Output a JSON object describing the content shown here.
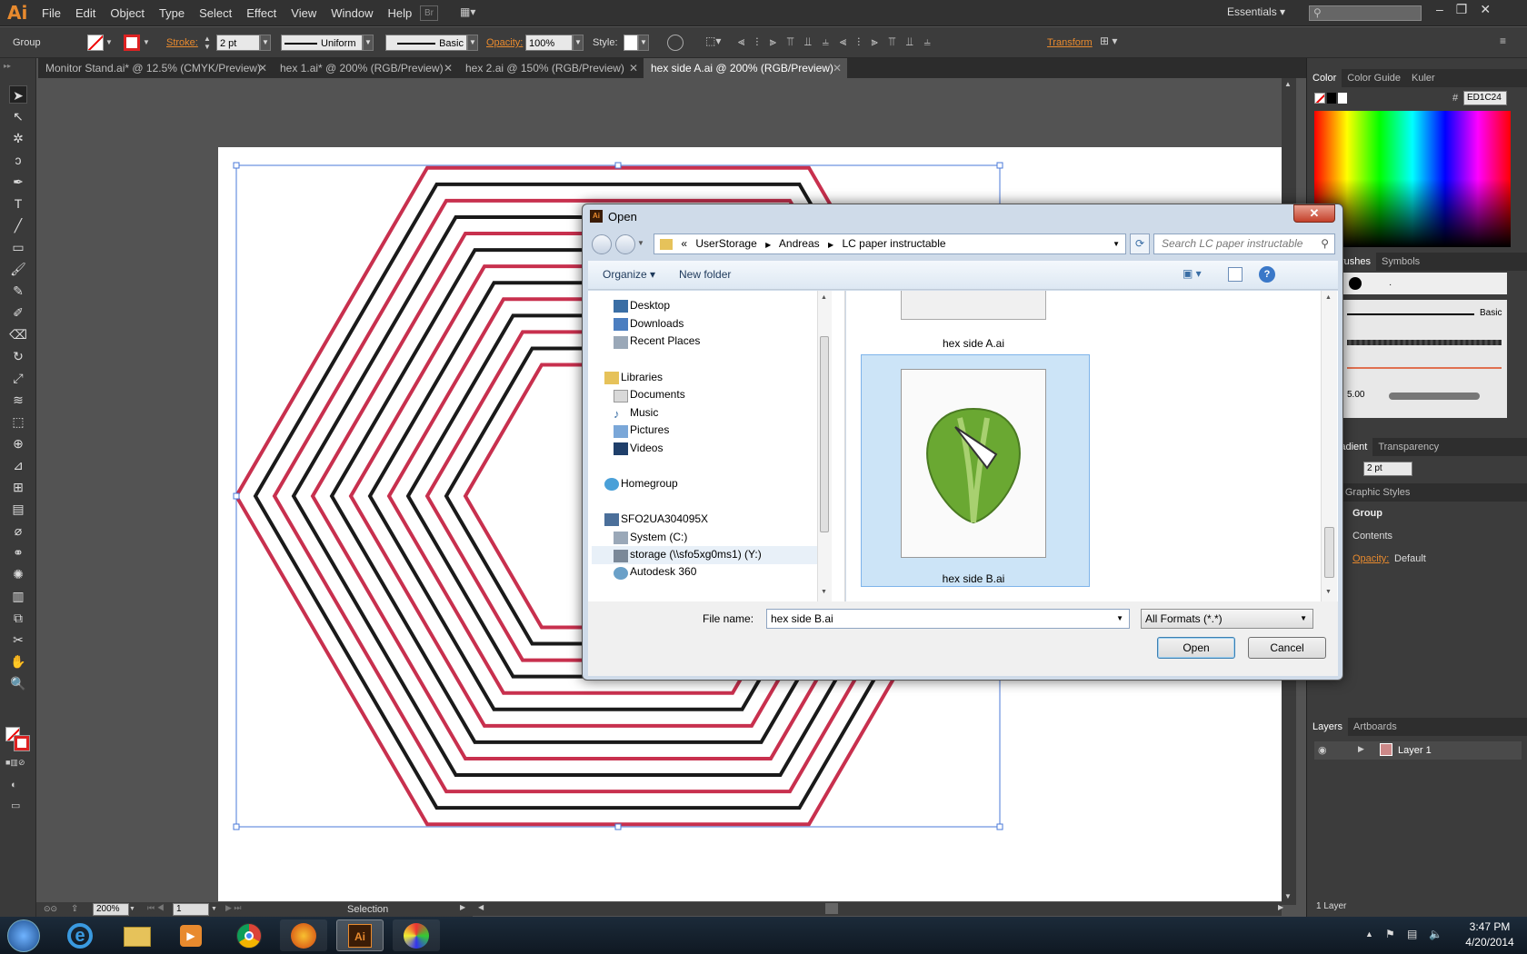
{
  "menubar": {
    "logo": "Ai",
    "items": [
      "File",
      "Edit",
      "Object",
      "Type",
      "Select",
      "Effect",
      "View",
      "Window",
      "Help"
    ],
    "workspace": "Essentials"
  },
  "control": {
    "selection_type": "Group",
    "stroke_label": "Stroke:",
    "stroke_weight": "2 pt",
    "profile": "Uniform",
    "brush": "Basic",
    "opacity_label": "Opacity:",
    "opacity_value": "100%",
    "style_label": "Style:",
    "transform_label": "Transform"
  },
  "tabs": [
    {
      "label": "Monitor Stand.ai* @ 12.5% (CMYK/Preview)"
    },
    {
      "label": "hex 1.ai* @ 200% (RGB/Preview)"
    },
    {
      "label": "hex 2.ai @ 150% (RGB/Preview)"
    },
    {
      "label": "hex side A.ai @ 200% (RGB/Preview)"
    }
  ],
  "status": {
    "zoom": "200%",
    "artboard": "1",
    "tool": "Selection"
  },
  "panels": {
    "color_tabs": [
      "Color",
      "Color Guide",
      "Kuler"
    ],
    "hex_value": "ED1C24",
    "brushes_tabs": [
      "es",
      "Brushes",
      "Symbols"
    ],
    "brush_basic": "Basic",
    "brush_size": "5.00",
    "stroke_tabs": [
      "e",
      "Gradient",
      "Transparency"
    ],
    "stroke_weight": "2 pt",
    "appearance_tabs": [
      "ance",
      "Graphic Styles"
    ],
    "appearance_group": "Group",
    "appearance_contents": "Contents",
    "appearance_opacity_label": "Opacity:",
    "appearance_opacity_value": "Default",
    "layers_tabs": [
      "Layers",
      "Artboards"
    ],
    "layer_name": "Layer 1",
    "layer_count": "1 Layer"
  },
  "dialog": {
    "title": "Open",
    "breadcrumb": [
      "UserStorage",
      "Andreas",
      "LC paper instructable"
    ],
    "breadcrumb_prefix": "«",
    "search_placeholder": "Search LC paper instructable",
    "organize": "Organize",
    "new_folder": "New folder",
    "nav": {
      "favorites": [
        "Desktop",
        "Downloads",
        "Recent Places"
      ],
      "libraries_label": "Libraries",
      "libraries": [
        "Documents",
        "Music",
        "Pictures",
        "Videos"
      ],
      "homegroup": "Homegroup",
      "computer": "SFO2UA304095X",
      "drives": [
        "System (C:)",
        "storage (\\\\sfo5xg0ms1) (Y:)",
        "Autodesk 360"
      ]
    },
    "files": [
      {
        "name": "hex side A.ai"
      },
      {
        "name": "hex side B.ai"
      }
    ],
    "file_name_label": "File name:",
    "file_name_value": "hex side B.ai",
    "filter": "All Formats (*.*)",
    "open_button": "Open",
    "cancel_button": "Cancel"
  },
  "taskbar": {
    "time": "3:47 PM",
    "date": "4/20/2014"
  },
  "colors": {
    "accent_orange": "#e88a2e",
    "hex_red": "#c8304e",
    "hex_black": "#1a1a1a",
    "selection_blue": "#4a78d8"
  }
}
